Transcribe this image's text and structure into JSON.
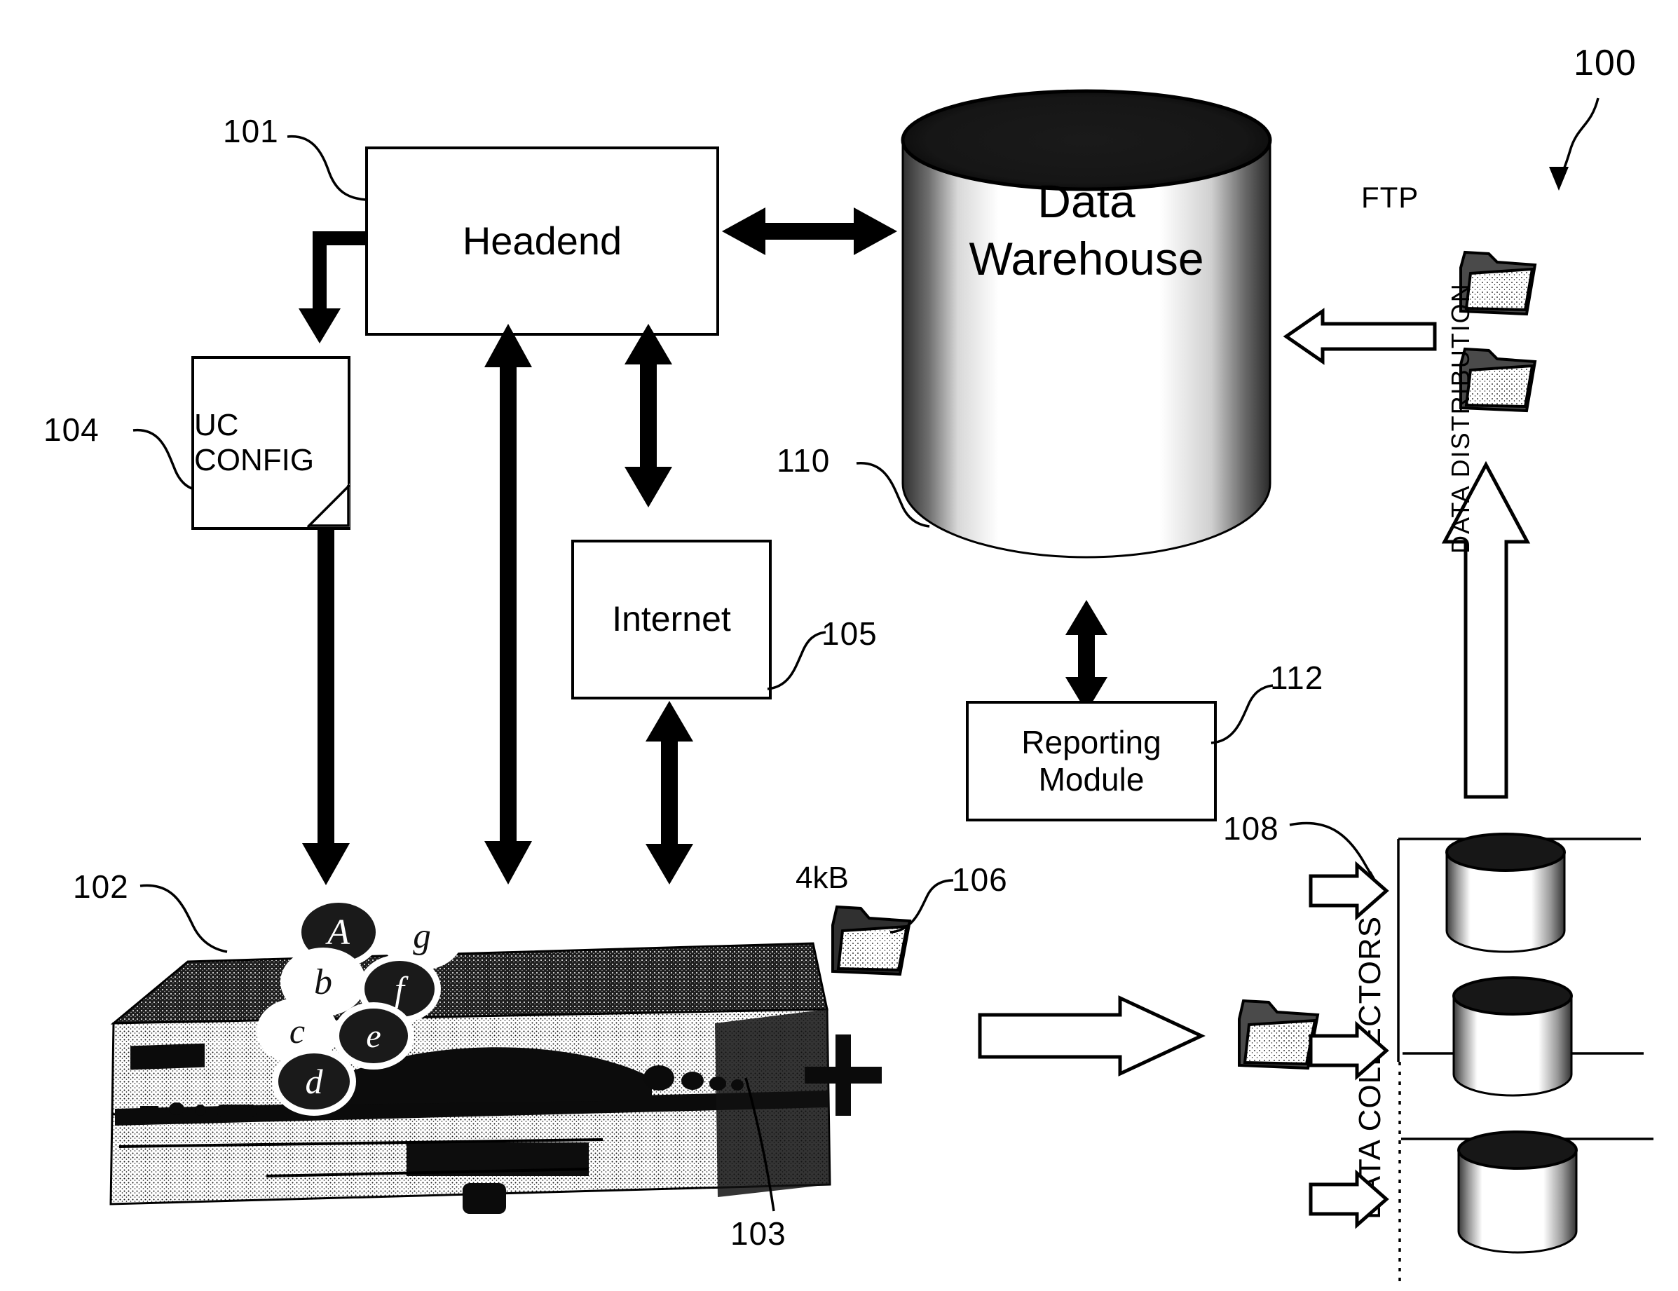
{
  "figure": {
    "system_ref": "100",
    "refs": {
      "headend": "101",
      "set_top_box": "102",
      "set_top_detail": "103",
      "uc_config": "104",
      "internet": "105",
      "stb_data_file": "106",
      "data_collectors": "108",
      "data_warehouse": "110",
      "reporting_module": "112"
    }
  },
  "nodes": {
    "headend": {
      "label": "Headend"
    },
    "uc_config": {
      "label": "UC CONFIG"
    },
    "internet": {
      "label": "Internet"
    },
    "data_warehouse": {
      "label_line1": "Data",
      "label_line2": "Warehouse"
    },
    "reporting_module": {
      "label_line1": "Reporting",
      "label_line2": "Module"
    }
  },
  "annotations": {
    "ftp": "FTP",
    "data_distribution": "DATA DISTRIBUTION",
    "data_collectors": "DATA COLLECTORS",
    "file_size": "4kB"
  },
  "set_top_box": {
    "badges": [
      {
        "letter": "A",
        "style": "dark"
      },
      {
        "letter": "g",
        "style": "light"
      },
      {
        "letter": "b",
        "style": "light"
      },
      {
        "letter": "f",
        "style": "dark"
      },
      {
        "letter": "c",
        "style": "light"
      },
      {
        "letter": "e",
        "style": "dark"
      },
      {
        "letter": "d",
        "style": "dark"
      }
    ]
  },
  "collectors": {
    "count": 3
  },
  "colors": {
    "ink": "#000000",
    "paper": "#ffffff"
  }
}
